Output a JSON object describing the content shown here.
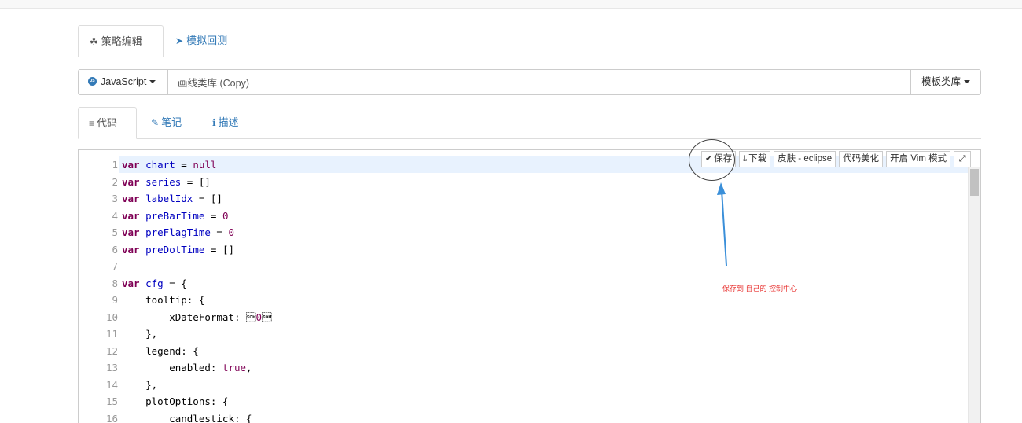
{
  "main_tabs": [
    {
      "label": "策略编辑",
      "icon": "cubes-icon",
      "active": true
    },
    {
      "label": "模拟回测",
      "icon": "rocket-icon",
      "active": false
    }
  ],
  "language": {
    "selected": "JavaScript"
  },
  "strategy_name": {
    "value": "画线类库 (Copy)"
  },
  "template_button": {
    "label": "模板类库"
  },
  "sub_tabs": [
    {
      "label": "代码",
      "icon": "list-icon",
      "active": true
    },
    {
      "label": "笔记",
      "icon": "edit-icon",
      "active": false
    },
    {
      "label": "描述",
      "icon": "info-icon",
      "active": false
    }
  ],
  "toolbar": {
    "save": "保存",
    "download": "下载",
    "skin": "皮肤 - eclipse",
    "beautify": "代码美化",
    "vim": "开启 Vim 模式"
  },
  "annotation": {
    "text": "保存到 自己的 控制中心"
  },
  "code_lines": [
    {
      "n": "1",
      "text": "var chart = null"
    },
    {
      "n": "2",
      "text": "var series = []"
    },
    {
      "n": "3",
      "text": "var labelIdx = []"
    },
    {
      "n": "4",
      "text": "var preBarTime = 0"
    },
    {
      "n": "5",
      "text": "var preFlagTime = 0"
    },
    {
      "n": "6",
      "text": "var preDotTime = []"
    },
    {
      "n": "7",
      "text": ""
    },
    {
      "n": "8",
      "text": "var cfg = {"
    },
    {
      "n": "9",
      "text": "    tooltip: {"
    },
    {
      "n": "10",
      "text": "        xDateFormat: '%Y-%m-%d %H:%M:%S, %A'"
    },
    {
      "n": "11",
      "text": "    },"
    },
    {
      "n": "12",
      "text": "    legend: {"
    },
    {
      "n": "13",
      "text": "        enabled: true,"
    },
    {
      "n": "14",
      "text": "    },"
    },
    {
      "n": "15",
      "text": "    plotOptions: {"
    },
    {
      "n": "16",
      "text": "        candlestick: {"
    }
  ],
  "colors": {
    "accent": "#337ab7",
    "annotation": "#e8312f",
    "arrow": "#3a8fd9",
    "active_line": "#e8f2fe"
  }
}
